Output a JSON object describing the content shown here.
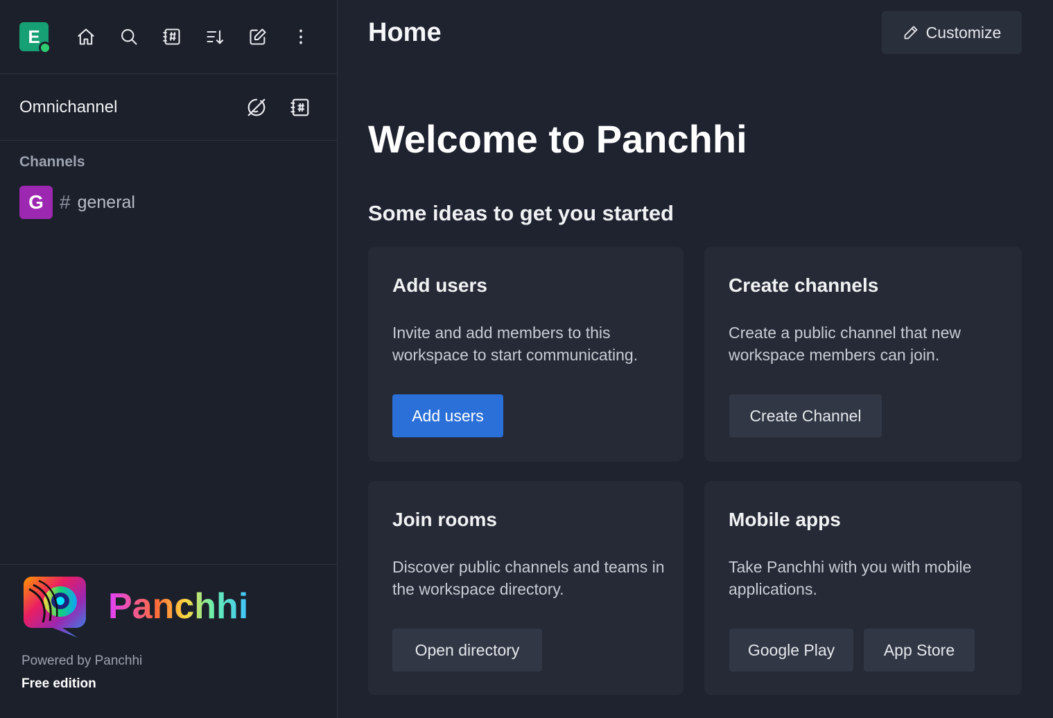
{
  "sidebar": {
    "workspace_initial": "E",
    "omnichannel_label": "Omnichannel",
    "channels_label": "Channels",
    "channels": [
      {
        "initial": "G",
        "hash": "#",
        "name": "general"
      }
    ],
    "footer": {
      "brand_name": "Panchhi",
      "powered_by": "Powered by Panchhi",
      "edition": "Free edition"
    }
  },
  "header": {
    "title": "Home",
    "customize_label": "Customize"
  },
  "main": {
    "welcome": "Welcome to Panchhi",
    "ideas_heading": "Some ideas to get you started",
    "cards": [
      {
        "title": "Add users",
        "description": "Invite and add members to this workspace to start communicating.",
        "buttons": [
          "Add users"
        ]
      },
      {
        "title": "Create channels",
        "description": "Create a public channel that new workspace members can join.",
        "buttons": [
          "Create Channel"
        ]
      },
      {
        "title": "Join rooms",
        "description": "Discover public channels and teams in the workspace directory.",
        "buttons": [
          "Open directory"
        ]
      },
      {
        "title": "Mobile apps",
        "description": "Take Panchhi with you with mobile applications.",
        "buttons": [
          "Google Play",
          "App Store"
        ]
      }
    ]
  },
  "colors": {
    "background": "#1f2330",
    "sidebar": "#1c202b",
    "card": "#252a36",
    "primary_button": "#2b6fd8",
    "workspace_avatar": "#17a073",
    "channel_avatar": "#9c27b0",
    "status_online": "#2ecc71"
  },
  "icons": [
    "home-icon",
    "search-icon",
    "directory-icon",
    "sort-icon",
    "create-new-icon",
    "kebab-menu-icon",
    "omnichannel-offline-icon",
    "contact-center-icon",
    "pencil-icon"
  ]
}
